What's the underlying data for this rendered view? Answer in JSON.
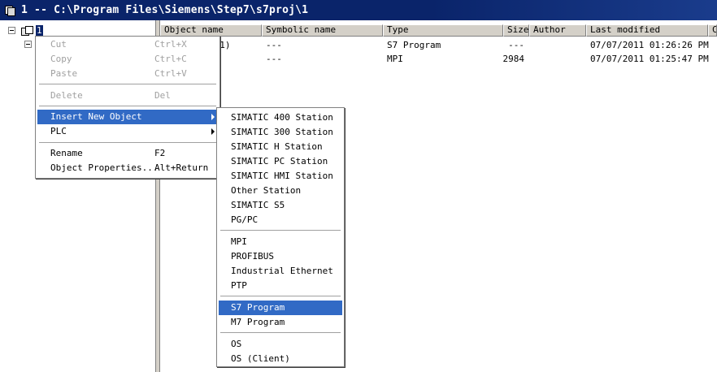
{
  "window": {
    "title": "1 -- C:\\Program Files\\Siemens\\Step7\\s7proj\\1"
  },
  "tree": {
    "selected_label": "1"
  },
  "list": {
    "columns": [
      "Object name",
      "Symbolic name",
      "Type",
      "Size",
      "Author",
      "Last modified",
      "C"
    ],
    "rows": [
      {
        "name": "n(1)",
        "symbolic": "---",
        "type": "S7 Program",
        "size": "---",
        "author": "",
        "modified": "07/07/2011 01:26:26 PM"
      },
      {
        "name": "",
        "symbolic": "---",
        "type": "MPI",
        "size": "2984",
        "author": "",
        "modified": "07/07/2011 01:25:47 PM"
      }
    ]
  },
  "context_menu": {
    "items": [
      {
        "label": "Cut",
        "shortcut": "Ctrl+X",
        "disabled": true
      },
      {
        "label": "Copy",
        "shortcut": "Ctrl+C",
        "disabled": true
      },
      {
        "label": "Paste",
        "shortcut": "Ctrl+V",
        "disabled": true
      },
      {
        "label": "Delete",
        "shortcut": "Del",
        "disabled": true
      },
      {
        "label": "Insert New Object",
        "shortcut": "",
        "highlighted": true,
        "submenu": true
      },
      {
        "label": "PLC",
        "shortcut": "",
        "submenu": true
      },
      {
        "label": "Rename",
        "shortcut": "F2"
      },
      {
        "label": "Object Properties...",
        "shortcut": "Alt+Return"
      }
    ]
  },
  "submenu": {
    "items": [
      "SIMATIC 400 Station",
      "SIMATIC 300 Station",
      "SIMATIC H Station",
      "SIMATIC PC Station",
      "SIMATIC HMI Station",
      "Other Station",
      "SIMATIC S5",
      "PG/PC",
      "MPI",
      "PROFIBUS",
      "Industrial Ethernet",
      "PTP",
      "S7 Program",
      "M7 Program",
      "OS",
      "OS (Client)"
    ],
    "highlighted": "S7 Program"
  },
  "colors": {
    "title_bar": "#0a246a",
    "menu_highlight": "#316ac5",
    "header_bg": "#d4d0c8"
  }
}
